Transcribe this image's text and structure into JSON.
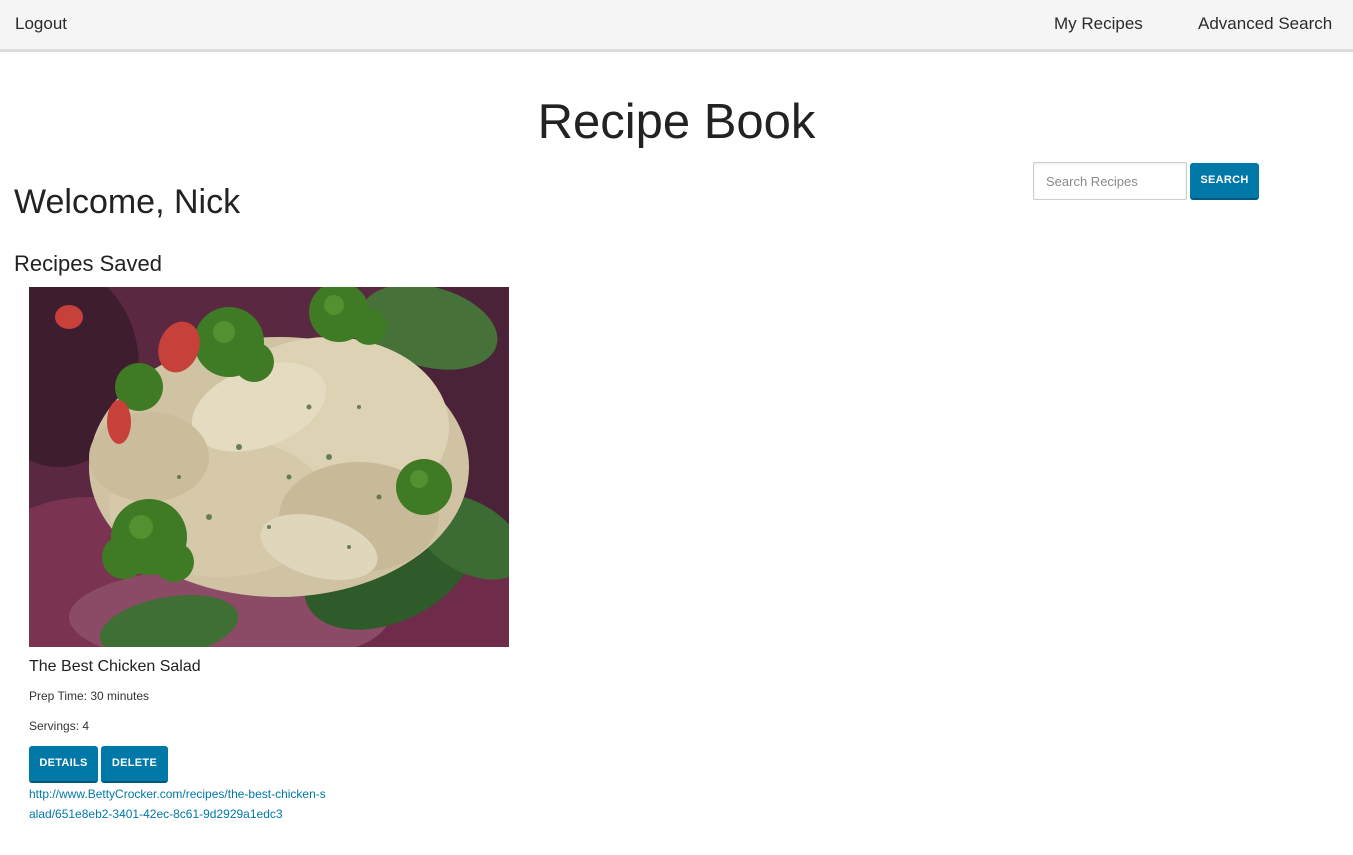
{
  "nav": {
    "logout_label": "Logout",
    "my_recipes_label": "My Recipes",
    "advanced_search_label": "Advanced Search"
  },
  "page": {
    "title": "Recipe Book",
    "welcome": "Welcome, Nick",
    "section_heading": "Recipes Saved"
  },
  "search": {
    "placeholder": "Search Recipes",
    "value": "",
    "button_label": "SEARCH"
  },
  "recipes": [
    {
      "title": "The Best Chicken Salad",
      "prep_time": "Prep Time: 30 minutes",
      "servings": "Servings: 4",
      "details_label": "DETAILS",
      "delete_label": "DELETE",
      "url": "http://www.BettyCrocker.com/recipes/the-best-chicken-salad/651e8eb2-3401-42ec-8c61-9d2929a1edc3",
      "image": "chicken-salad-photo"
    }
  ],
  "colors": {
    "accent": "#0078a8",
    "topbar_bg": "#f5f5f5",
    "text": "#222222"
  }
}
